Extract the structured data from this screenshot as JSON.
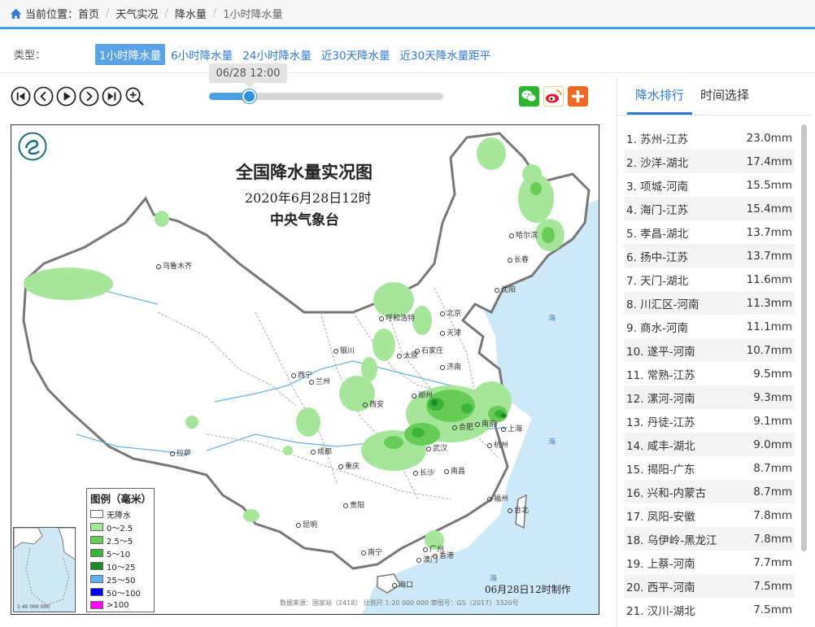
{
  "breadcrumb": {
    "prefix": "当前位置：",
    "items": [
      "首页",
      "天气实况",
      "降水量",
      "1小时降水量"
    ]
  },
  "type_row": {
    "label": "类型：",
    "tabs": [
      "1小时降水量",
      "6小时降水量",
      "24小时降水量",
      "近30天降水量",
      "近30天降水量距平"
    ],
    "active_index": 0
  },
  "player": {
    "time_label": "06/28 12:00",
    "progress": 0.17,
    "controls": [
      "first-icon",
      "prev-icon",
      "play-icon",
      "next-icon",
      "last-icon",
      "zoom-in-icon"
    ]
  },
  "share": [
    "wechat-icon",
    "weibo-icon",
    "more-share-icon"
  ],
  "map": {
    "title": "全国降水量实况图",
    "date": "2020年6月28日12时",
    "org": "中央气象台",
    "made": "06月28日12时制作",
    "source": "数据来源：国家站（2418） 比例尺 1:20 000 000  审图号：GS（2017）3320号",
    "inset_scale": "1:40 000 000",
    "legend_title": "图例（毫米）",
    "legend": [
      {
        "label": "无降水",
        "color": "#ffffff"
      },
      {
        "label": "0～2.5",
        "color": "#a6e69a"
      },
      {
        "label": "2.5～5",
        "color": "#66cc55"
      },
      {
        "label": "5～10",
        "color": "#39b33a"
      },
      {
        "label": "10～25",
        "color": "#1e8a24"
      },
      {
        "label": "25～50",
        "color": "#5fb3f0"
      },
      {
        "label": "50～100",
        "color": "#0000e6"
      },
      {
        "label": ">100",
        "color": "#ff00ff"
      }
    ],
    "cities": [
      "乌鲁木齐",
      "哈尔滨",
      "长春",
      "沈阳",
      "北京",
      "天津",
      "呼和浩特",
      "石家庄",
      "太原",
      "济南",
      "银川",
      "西宁",
      "兰州",
      "西安",
      "郑州",
      "合肥",
      "南京",
      "上海",
      "武汉",
      "杭州",
      "成都",
      "重庆",
      "拉萨",
      "长沙",
      "南昌",
      "贵阳",
      "昆明",
      "福州",
      "台北",
      "南宁",
      "广州",
      "香港",
      "澳门",
      "海口"
    ],
    "seas": [
      "海",
      "海",
      "海"
    ]
  },
  "panel": {
    "tabs": [
      "降水排行",
      "时间选择"
    ],
    "active_tab": 0,
    "ranking": [
      {
        "name": "1. 苏州-江苏",
        "value": "23.0mm"
      },
      {
        "name": "2. 沙洋-湖北",
        "value": "17.4mm"
      },
      {
        "name": "3. 项城-河南",
        "value": "15.5mm"
      },
      {
        "name": "4. 海门-江苏",
        "value": "15.4mm"
      },
      {
        "name": "5. 孝昌-湖北",
        "value": "13.7mm"
      },
      {
        "name": "6. 扬中-江苏",
        "value": "13.7mm"
      },
      {
        "name": "7. 天门-湖北",
        "value": "11.6mm"
      },
      {
        "name": "8. 川汇区-河南",
        "value": "11.3mm"
      },
      {
        "name": "9. 商水-河南",
        "value": "11.1mm"
      },
      {
        "name": "10. 遂平-河南",
        "value": "10.7mm"
      },
      {
        "name": "11. 常熟-江苏",
        "value": "9.5mm"
      },
      {
        "name": "12. 漯河-河南",
        "value": "9.3mm"
      },
      {
        "name": "13. 丹徒-江苏",
        "value": "9.1mm"
      },
      {
        "name": "14. 咸丰-湖北",
        "value": "9.0mm"
      },
      {
        "name": "15. 揭阳-广东",
        "value": "8.7mm"
      },
      {
        "name": "16. 兴和-内蒙古",
        "value": "8.7mm"
      },
      {
        "name": "17. 凤阳-安徽",
        "value": "7.8mm"
      },
      {
        "name": "18. 乌伊岭-黑龙江",
        "value": "7.8mm"
      },
      {
        "name": "19. 上蔡-河南",
        "value": "7.7mm"
      },
      {
        "name": "20. 西平-河南",
        "value": "7.5mm"
      },
      {
        "name": "21. 汉川-湖北",
        "value": "7.5mm"
      }
    ]
  }
}
